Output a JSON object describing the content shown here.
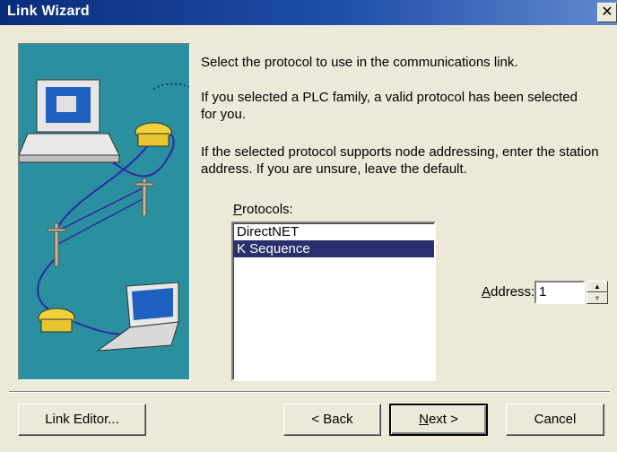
{
  "window": {
    "title": "Link Wizard",
    "close_glyph": "✕"
  },
  "instructions": {
    "line1": "Select the protocol to use in the communications link.",
    "line2": "If you selected a PLC family, a valid protocol has been selected for you.",
    "line3": "If the selected protocol supports node addressing, enter the station address. If you are unsure, leave the default."
  },
  "protocols": {
    "label_ul": "P",
    "label_rest": "rotocols:",
    "items": [
      "DirectNET",
      "K Sequence"
    ],
    "selected": "K Sequence"
  },
  "address": {
    "label_ul": "A",
    "label_rest": "ddress:",
    "value": "1"
  },
  "buttons": {
    "link_editor": "Link Editor...",
    "back": "< Back",
    "next_ul": "N",
    "next_rest": "ext >",
    "cancel": "Cancel"
  },
  "colors": {
    "illustration_bg": "#2a8f9e",
    "selection": "#2a2f6e",
    "title_bar": "#0a2d7a"
  },
  "icons": [
    "computer-icon",
    "telephone-icon",
    "utility-pole-icon",
    "laptop-icon"
  ]
}
